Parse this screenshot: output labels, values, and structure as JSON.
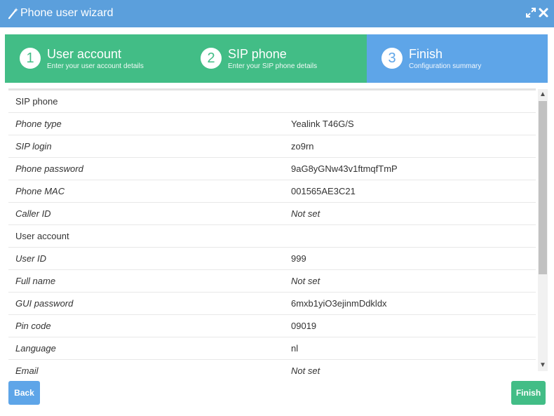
{
  "window": {
    "title": "Phone user wizard"
  },
  "steps": [
    {
      "number": "1",
      "title": "User account",
      "subtitle": "Enter your user account details",
      "state": "done"
    },
    {
      "number": "2",
      "title": "SIP phone",
      "subtitle": "Enter your SIP phone details",
      "state": "done"
    },
    {
      "number": "3",
      "title": "Finish",
      "subtitle": "Configuration summary",
      "state": "active"
    }
  ],
  "summary": {
    "rows": [
      {
        "label": "SIP phone",
        "value": "",
        "section": true
      },
      {
        "label": "Phone type",
        "value": "Yealink T46G/S"
      },
      {
        "label": "SIP login",
        "value": "zo9rn"
      },
      {
        "label": "Phone password",
        "value": "9aG8yGNw43v1ftmqfTmP"
      },
      {
        "label": "Phone MAC",
        "value": "001565AE3C21"
      },
      {
        "label": "Caller ID",
        "value": "Not set",
        "italic": true
      },
      {
        "label": "User account",
        "value": "",
        "section": true
      },
      {
        "label": "User ID",
        "value": "999"
      },
      {
        "label": "Full name",
        "value": "Not set",
        "italic": true
      },
      {
        "label": "GUI password",
        "value": "6mxb1yiO3ejinmDdkldx"
      },
      {
        "label": "Pin code",
        "value": "09019"
      },
      {
        "label": "Language",
        "value": "nl"
      },
      {
        "label": "Email",
        "value": "Not set",
        "italic": true
      }
    ]
  },
  "buttons": {
    "back": "Back",
    "finish": "Finish"
  },
  "colors": {
    "titlebar": "#5b9fdc",
    "step_done": "#42bd86",
    "step_active": "#5ea5e8"
  }
}
